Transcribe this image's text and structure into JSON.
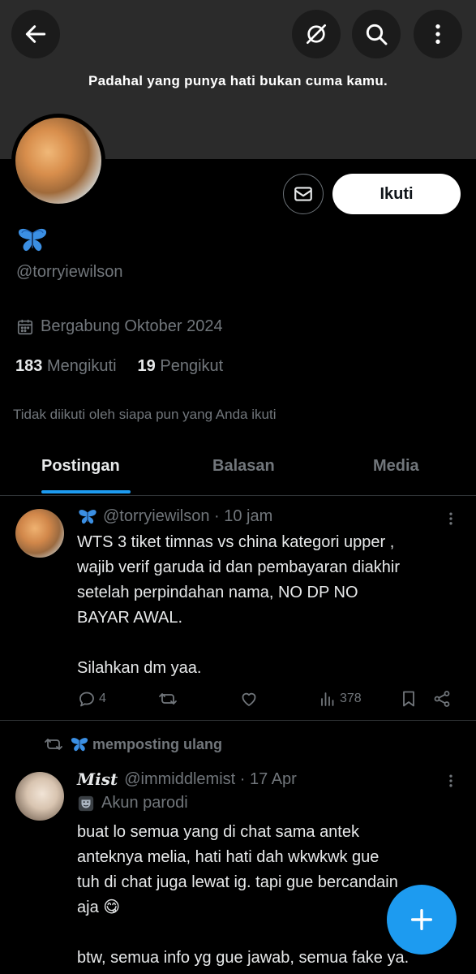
{
  "header": {
    "banner_text": "Padahal yang punya hati bukan cuma kamu.",
    "back_icon": "arrow-left-icon",
    "grok_icon": "grok-slash-icon",
    "search_icon": "search-icon",
    "more_icon": "more-vertical-icon"
  },
  "profile": {
    "display_name_emoji": "🦋",
    "handle": "@torryiewilson",
    "joined": "Bergabung Oktober 2024",
    "following_count": "183",
    "following_label": "Mengikuti",
    "followers_count": "19",
    "followers_label": "Pengikut",
    "not_followed_text": "Tidak diikuti oleh siapa pun yang Anda ikuti",
    "follow_button": "Ikuti"
  },
  "tabs": [
    {
      "label": "Postingan",
      "active": true
    },
    {
      "label": "Balasan",
      "active": false
    },
    {
      "label": "Media",
      "active": false
    }
  ],
  "posts": [
    {
      "handle": "@torryiewilson",
      "time": "10 jam",
      "body_lines": [
        "WTS 3 tiket timnas vs china kategori upper ,",
        "wajib verif garuda id dan pembayaran diakhir",
        "setelah perpindahan nama, NO DP NO",
        "BAYAR AWAL.",
        "",
        "Silahkan dm yaa."
      ],
      "replies": "4",
      "views": "378"
    },
    {
      "repost_label": "memposting ulang",
      "author_name": "Mist",
      "handle": "@immiddlemist",
      "time": "17 Apr",
      "badge": "Akun parodi",
      "body_lines": [
        "buat lo semua yang di chat sama antek",
        "anteknya melia, hati hati dah wkwkwk gue",
        "tuh di chat juga lewat ig. tapi gue bercandain",
        "aja 😋",
        "",
        "btw, semua info yg gue jawab, semua fake ya."
      ]
    }
  ],
  "colors": {
    "accent": "#1d9bf0",
    "text_primary": "#e7e9ea",
    "text_secondary": "#71767b",
    "background": "#000000",
    "banner": "#2b2b2b"
  }
}
